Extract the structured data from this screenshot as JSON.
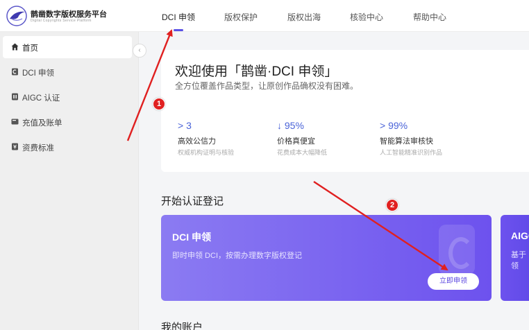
{
  "brand": {
    "name": "鹊凿数字版权服务平台",
    "subtitle": "Digital Copyrights Service Platform"
  },
  "nav": [
    {
      "label": "DCI 申领",
      "active": true
    },
    {
      "label": "版权保护"
    },
    {
      "label": "版权出海"
    },
    {
      "label": "核验中心"
    },
    {
      "label": "帮助中心"
    }
  ],
  "sidebar": {
    "items": [
      {
        "label": "首页",
        "icon": "home-icon",
        "active": true
      },
      {
        "label": "DCI 申领",
        "icon": "dci-icon"
      },
      {
        "label": "AIGC 认证",
        "icon": "aigc-icon"
      },
      {
        "label": "充值及账单",
        "icon": "wallet-icon"
      },
      {
        "label": "资费标准",
        "icon": "fee-icon"
      }
    ],
    "collapse_icon": "chevron-left-icon"
  },
  "welcome": {
    "title": "欢迎使用「鹊凿·DCI 申领」",
    "subtitle": "全方位覆盖作品类型，让原创作品确权没有困难。",
    "stats": [
      {
        "value": "> 3",
        "name": "高效公信力",
        "desc": "权威机构证明与核验"
      },
      {
        "value": "↓ 95%",
        "name": "价格真便宜",
        "desc": "花费成本大幅降低"
      },
      {
        "value": "> 99%",
        "name": "智能算法审核快",
        "desc": "人工智能精准识别作品"
      }
    ]
  },
  "section": {
    "title": "开始认证登记"
  },
  "dci_card": {
    "title": "DCI 申领",
    "desc": "即时申领 DCI，按需办理数字版权登记",
    "button": "立即申领"
  },
  "aigc_card": {
    "title": "AIGC",
    "desc": "基于领"
  },
  "account": {
    "title": "我的账户"
  },
  "annotations": {
    "badge_1": "1",
    "badge_2": "2",
    "arrow_color": "#e02020"
  }
}
